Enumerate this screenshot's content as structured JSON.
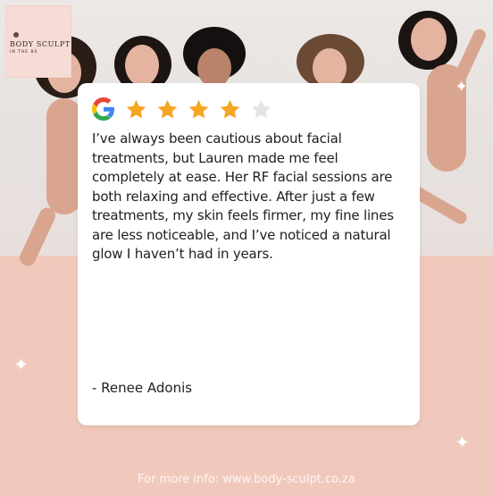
{
  "brand": {
    "logo_title": "BODY SCULPT",
    "logo_subtitle": "IN THE 80"
  },
  "review": {
    "source_icon": "google-icon",
    "rating": 4,
    "max_rating": 5,
    "text": "I’ve always been cautious about facial treatments, but Lauren made me feel completely at ease. Her RF facial sessions are both relaxing and effective. After just a few treatments, my skin feels firmer, my fine lines are less noticeable, and I’ve noticed a natural glow I haven’t had in years.",
    "reviewer": "- Renee Adonis"
  },
  "footer": {
    "text": "For more info: www.body-sculpt.co.za"
  },
  "colors": {
    "card_bg": "#ffffff",
    "star_filled": "#f5a623",
    "star_empty": "#e3e3e3",
    "accent_pink": "#f1c9bc",
    "text_dark": "#1f1f1f"
  }
}
